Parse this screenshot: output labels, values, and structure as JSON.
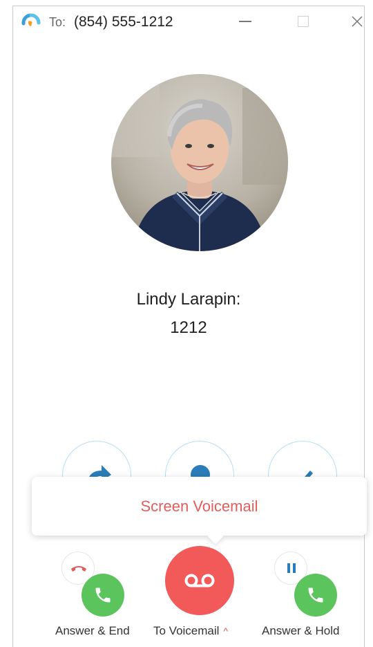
{
  "titlebar": {
    "to_label": "To:",
    "number": "(854) 555-1212",
    "logo_icon": "app-logo-icon",
    "controls": [
      "minimize-icon",
      "maximize-icon",
      "close-icon"
    ]
  },
  "caller": {
    "name": "Lindy Larapin:",
    "extension": "1212"
  },
  "actions": {
    "icons": [
      "forward-arrow-icon",
      "contact-person-icon",
      "edit-pencil-icon"
    ]
  },
  "popup": {
    "items": [
      {
        "label": "Screen Voicemail"
      }
    ]
  },
  "call_controls": {
    "answer_end": {
      "label": "Answer & End",
      "icons": [
        "hangup-icon",
        "phone-answer-icon"
      ]
    },
    "voicemail": {
      "label": "To Voicemail",
      "icon": "voicemail-icon",
      "caret": "^"
    },
    "answer_hold": {
      "label": "Answer & Hold",
      "icons": [
        "pause-icon",
        "phone-answer-icon"
      ]
    }
  },
  "colors": {
    "accent_red": "#f25a5a",
    "answer_green": "#5cc45c",
    "accent_blue": "#2a7db8",
    "popup_text": "#e45c5c"
  }
}
